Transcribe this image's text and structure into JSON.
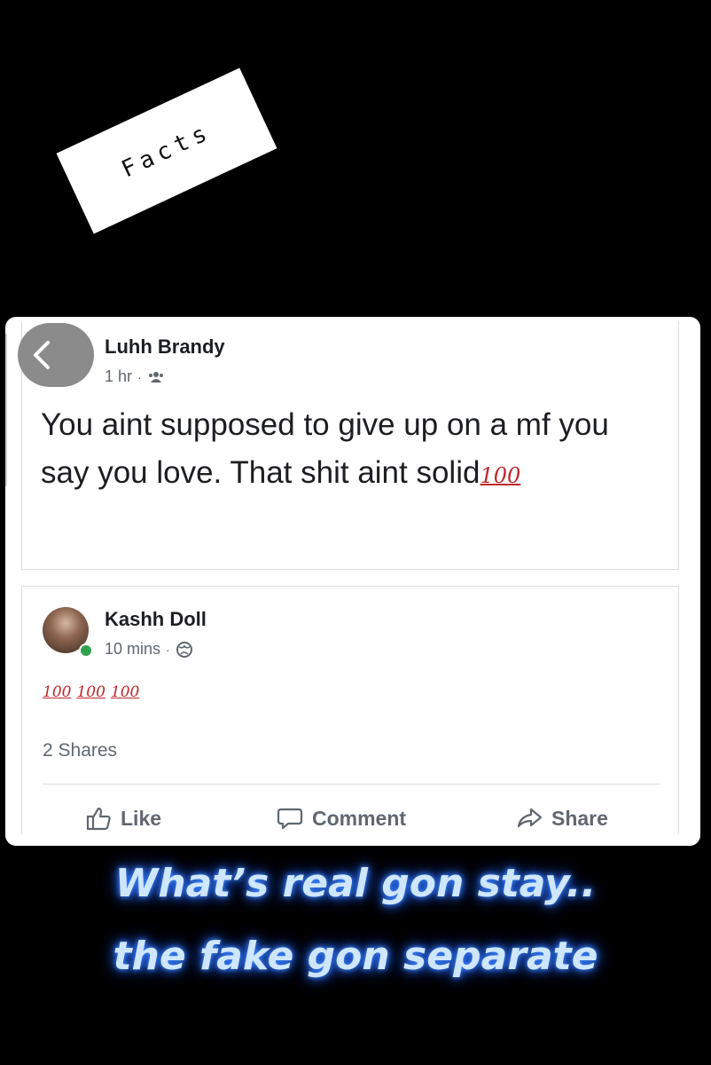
{
  "sticker": {
    "text": "Facts"
  },
  "shared_post": {
    "author": "Luhh Brandy",
    "time": "1 hr",
    "audience_icon": "friends-icon",
    "text": "You aint supposed to give up on a mf you say you love. That shit aint solid",
    "emoji": "100"
  },
  "post": {
    "author": "Kashh Doll",
    "time": "10 mins",
    "audience_icon": "globe-icon",
    "emojis": [
      "100",
      "100",
      "100"
    ],
    "shares": "2 Shares"
  },
  "actions": {
    "like": "Like",
    "comment": "Comment",
    "share": "Share"
  },
  "caption": {
    "line1": "What’s real gon stay..",
    "line2": "the fake gon separate"
  },
  "colors": {
    "emoji_red": "#c0272d",
    "caption_glow": "#3d8bff",
    "online": "#31a24c"
  }
}
